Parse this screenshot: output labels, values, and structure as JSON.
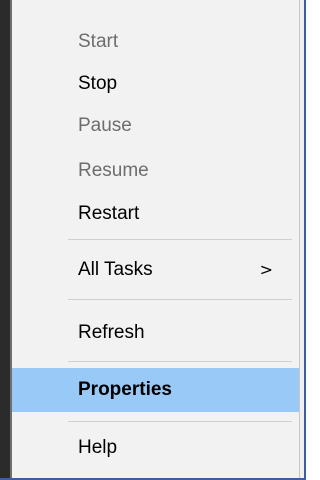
{
  "menu": {
    "items": [
      {
        "label": "Start",
        "state": "disabled"
      },
      {
        "label": "Stop",
        "state": "enabled"
      },
      {
        "label": "Pause",
        "state": "disabled"
      },
      {
        "label": "Resume",
        "state": "disabled"
      },
      {
        "label": "Restart",
        "state": "enabled"
      },
      {
        "label": "All Tasks",
        "state": "enabled",
        "submenu_arrow": ">"
      },
      {
        "label": "Refresh",
        "state": "enabled"
      },
      {
        "label": "Properties",
        "state": "selected"
      },
      {
        "label": "Help",
        "state": "enabled"
      }
    ]
  },
  "colors": {
    "highlight": "#99c9f7",
    "disabled_text": "#6d6d6d",
    "menu_background": "#f2f2f2",
    "frame_border": "#3b5fa0"
  },
  "icons": {
    "submenu": "chevron-right-icon"
  }
}
